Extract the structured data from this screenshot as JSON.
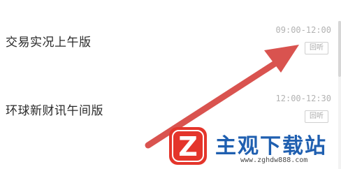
{
  "programs": [
    {
      "title": "交易实况上午版",
      "time": "09:00-12:00",
      "action_label": "回听"
    },
    {
      "title": "环球新财讯午间版",
      "time": "12:00-12:30",
      "action_label": "回听"
    }
  ],
  "watermark": {
    "name": "主观下载站",
    "url": "www.zghdw888.com",
    "logo_text": "Z"
  },
  "colors": {
    "arrow": "#d9534f",
    "watermark_blue": "#1f5fb0",
    "logo_red": "#e4352b"
  }
}
